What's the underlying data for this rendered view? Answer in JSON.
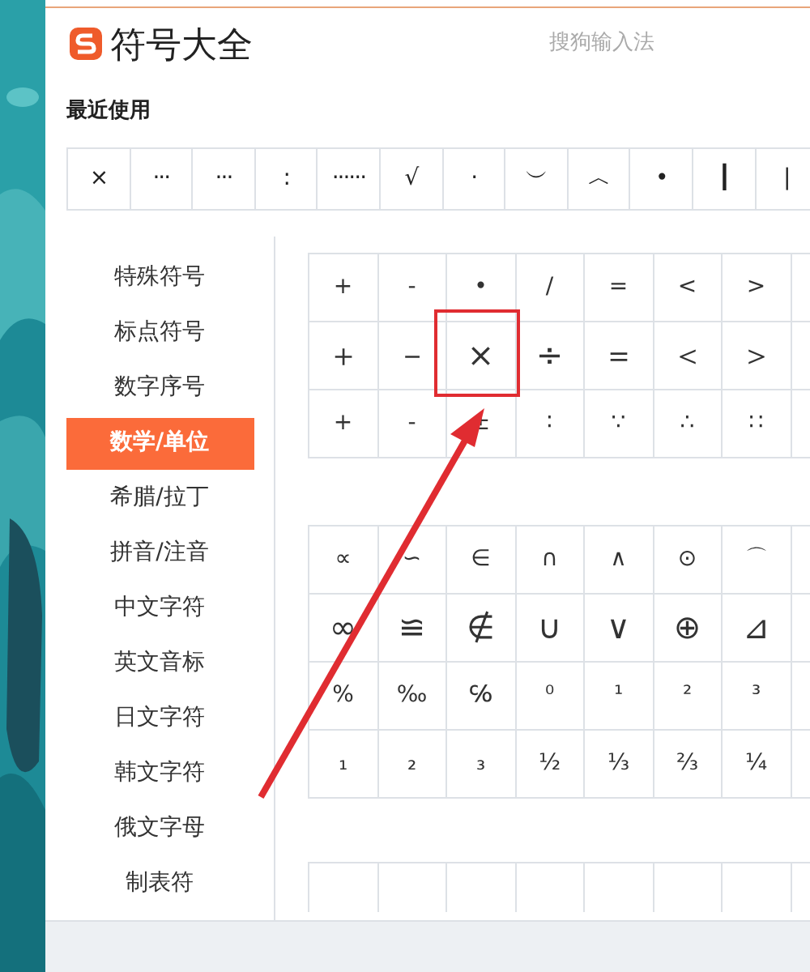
{
  "window": {
    "title": "符号大全",
    "brand": "搜狗输入法"
  },
  "recent": {
    "label": "最近使用",
    "symbols": [
      "×",
      "···",
      "···",
      "꞉",
      "······",
      "√",
      "·",
      "︶",
      "︿",
      "•",
      "┃",
      "|"
    ]
  },
  "sidebar": {
    "items": [
      {
        "label": "特殊符号",
        "selected": false
      },
      {
        "label": "标点符号",
        "selected": false
      },
      {
        "label": "数字序号",
        "selected": false
      },
      {
        "label": "数学/单位",
        "selected": true
      },
      {
        "label": "希腊/拉丁",
        "selected": false
      },
      {
        "label": "拼音/注音",
        "selected": false
      },
      {
        "label": "中文字符",
        "selected": false
      },
      {
        "label": "英文音标",
        "selected": false
      },
      {
        "label": "日文字符",
        "selected": false
      },
      {
        "label": "韩文字符",
        "selected": false
      },
      {
        "label": "俄文字母",
        "selected": false
      },
      {
        "label": "制表符",
        "selected": false
      }
    ]
  },
  "grids": [
    {
      "rows": [
        [
          "+",
          "-",
          "•",
          "/",
          "=",
          "<",
          ">"
        ],
        [
          "＋",
          "－",
          "×",
          "÷",
          "＝",
          "＜",
          "＞"
        ],
        [
          "+",
          "-",
          "±",
          "∶",
          "∵",
          "∴",
          "∷"
        ]
      ]
    },
    {
      "rows": [
        [
          "∝",
          "∽",
          "∈",
          "∩",
          "∧",
          "⊙",
          "⌒"
        ],
        [
          "∞",
          "≌",
          "∉",
          "∪",
          "∨",
          "⊕",
          "⊿"
        ],
        [
          "%",
          "‰",
          "℅",
          "⁰",
          "¹",
          "²",
          "³"
        ],
        [
          "₁",
          "₂",
          "₃",
          "½",
          "⅓",
          "⅔",
          "¼"
        ]
      ]
    }
  ]
}
